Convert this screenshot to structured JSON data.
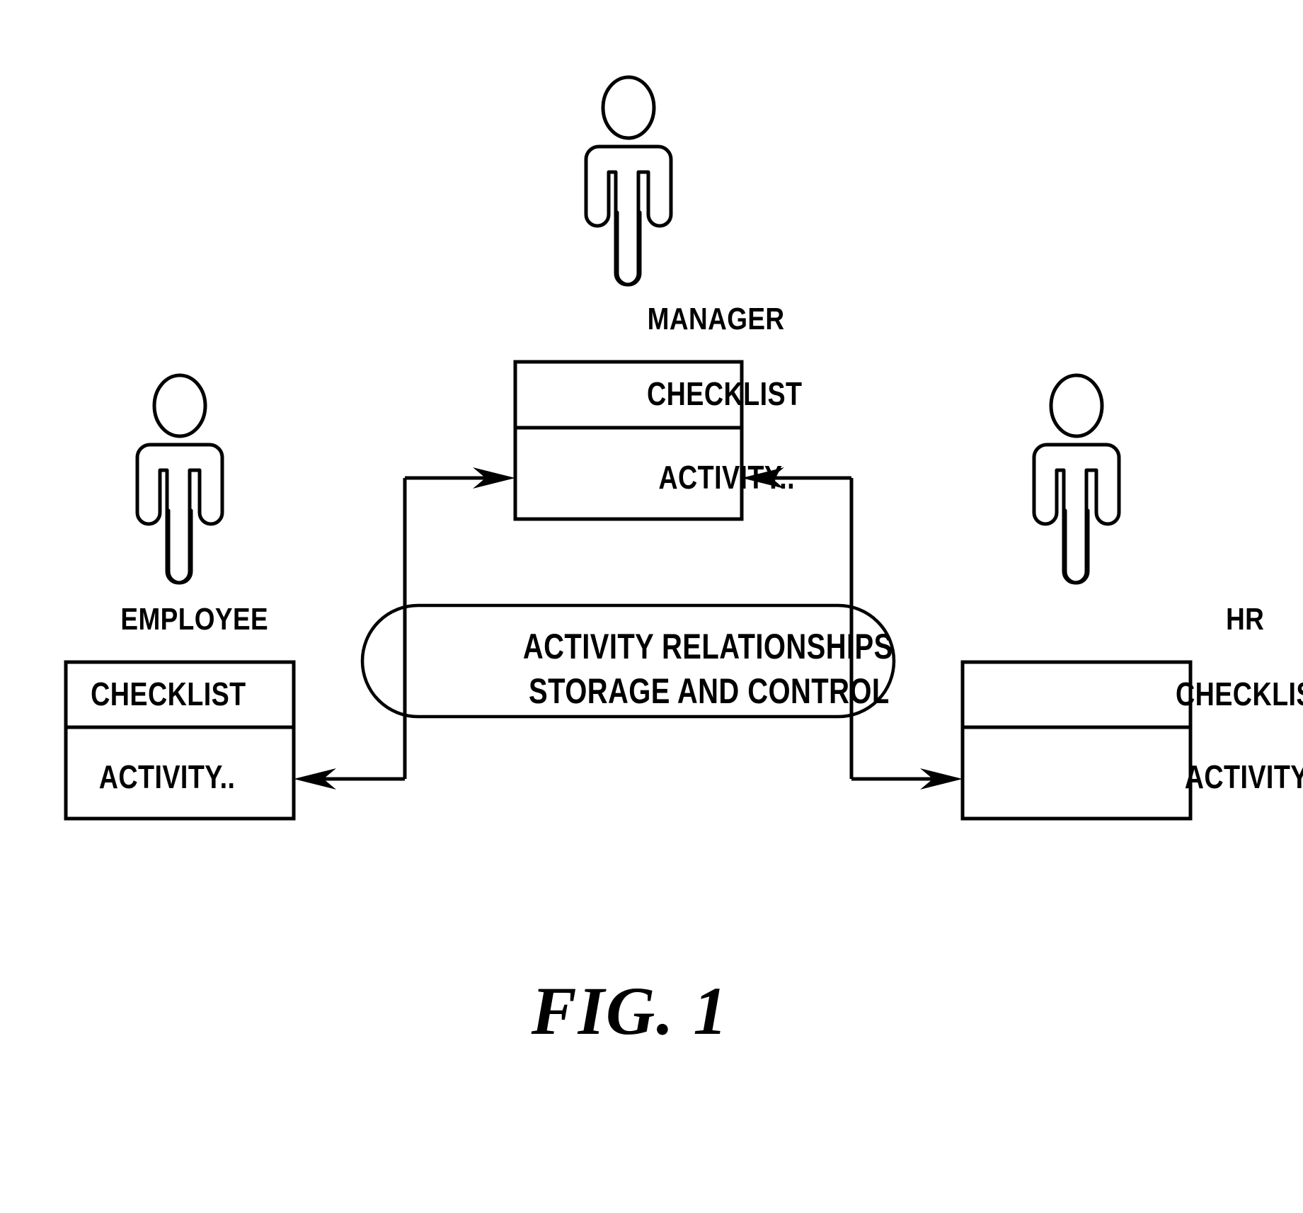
{
  "figure": {
    "caption": "FIG.  1",
    "background_color": "#ffffff",
    "line_color": "#000000"
  },
  "actors": [
    {
      "id": "employee",
      "role_label": "EMPLOYEE",
      "icon": "person-icon",
      "box": {
        "checklist_label": "CHECKLIST",
        "activity_label": "ACTIVITY.."
      }
    },
    {
      "id": "manager",
      "role_label": "MANAGER",
      "icon": "person-icon",
      "box": {
        "checklist_label": "CHECKLIST",
        "activity_label": "ACTIVITY.."
      }
    },
    {
      "id": "hr",
      "role_label": "HR",
      "icon": "person-icon",
      "box": {
        "checklist_label": "CHECKLIST",
        "activity_label": "ACTIVITY.."
      }
    }
  ],
  "central_store": {
    "id": "activity-relationships-store",
    "line1": "ACTIVITY RELATIONSHIPS",
    "line2": "STORAGE AND CONTROL",
    "shape": "stadium"
  },
  "connections": [
    {
      "id": "store-to-manager-left",
      "from": "activity-relationships-store",
      "to": "manager",
      "direction": "right"
    },
    {
      "id": "store-to-manager-right",
      "from": "activity-relationships-store",
      "to": "manager",
      "direction": "left"
    },
    {
      "id": "store-to-employee",
      "from": "activity-relationships-store",
      "to": "employee",
      "direction": "left"
    },
    {
      "id": "store-to-hr",
      "from": "activity-relationships-store",
      "to": "hr",
      "direction": "right"
    }
  ]
}
